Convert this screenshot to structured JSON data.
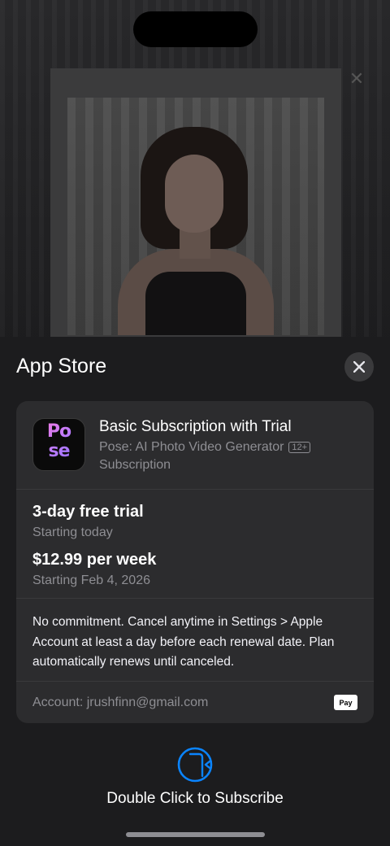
{
  "sheet": {
    "title": "App Store",
    "close_icon": "close-icon"
  },
  "product": {
    "icon_name": "pose-app-icon",
    "icon_text_line1": "Po",
    "icon_text_line2": "se",
    "title": "Basic Subscription with Trial",
    "app_name": "Pose: AI Photo Video Generator",
    "age_rating": "12+",
    "type": "Subscription"
  },
  "offer": {
    "trial_title": "3-day free trial",
    "trial_start": "Starting today",
    "price_title": "$12.99 per week",
    "price_start": "Starting Feb 4, 2026"
  },
  "terms": {
    "text": "No commitment. Cancel anytime in Settings > Apple Account at least a day before each renewal date. Plan automatically renews until canceled."
  },
  "account": {
    "label": "Account: jrushfinn@gmail.com",
    "payment_badge": "Pay"
  },
  "confirm": {
    "icon_name": "side-button-icon",
    "label": "Double Click to Subscribe"
  },
  "colors": {
    "accent_blue": "#0a84ff",
    "sheet_bg": "#1c1c1e",
    "card_bg": "#2c2c2e",
    "secondary_text": "#8e8e93"
  }
}
